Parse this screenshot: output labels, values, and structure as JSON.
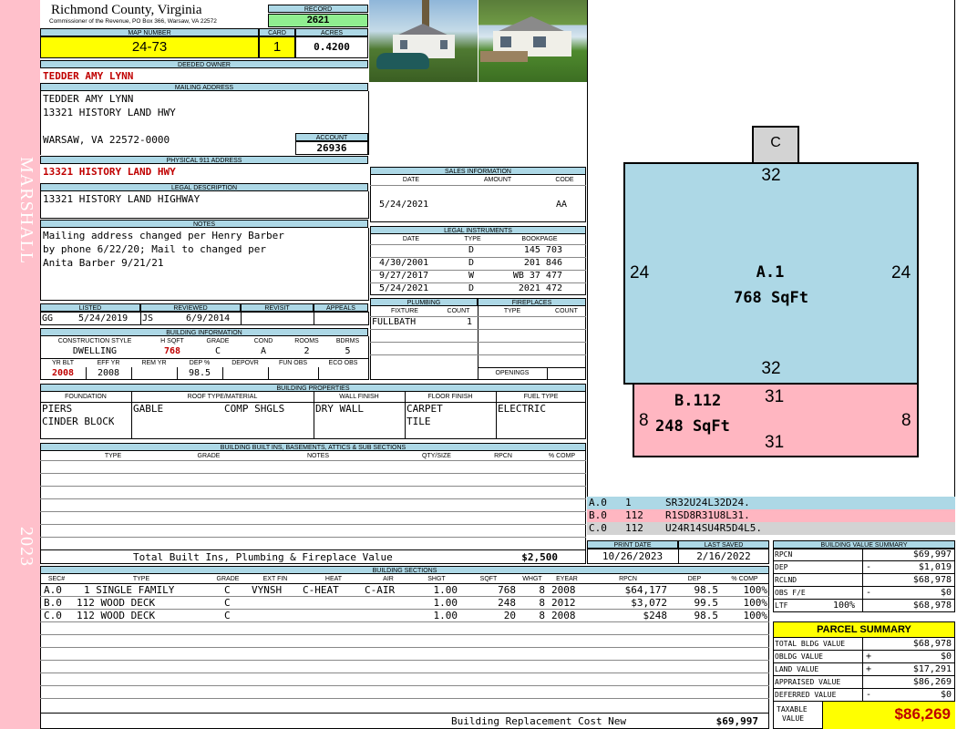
{
  "sidebar": {
    "top_text": "MARSHALL",
    "bottom_text": "2023"
  },
  "header": {
    "county": "Richmond County, Virginia",
    "commissioner": "Commissioner of the Revenue, PO Box 366, Warsaw, VA 22572",
    "record_label": "RECORD",
    "record_value": "2621",
    "map_label": "MAP NUMBER",
    "map_value": "24-73",
    "card_label": "CARD",
    "card_value": "1",
    "acres_label": "ACRES",
    "acres_value": "0.4200"
  },
  "owner": {
    "deeded_label": "DEEDED OWNER",
    "deeded_value": "TEDDER AMY LYNN",
    "mailing_label": "MAILING ADDRESS",
    "mailing_line1": "TEDDER AMY LYNN",
    "mailing_line2": "13321 HISTORY LAND HWY",
    "mailing_line3": "WARSAW, VA 22572-0000",
    "account_label": "ACCOUNT",
    "account_value": "26936",
    "physical_label": "PHYSICAL 911 ADDRESS",
    "physical_value": "13321 HISTORY LAND HWY",
    "legal_label": "LEGAL DESCRIPTION",
    "legal_value": "13321 HISTORY LAND HIGHWAY",
    "notes_label": "NOTES",
    "notes_line1": "Mailing address changed per Henry Barber",
    "notes_line2": "by phone 6/22/20; Mail to changed per",
    "notes_line3": "Anita Barber 9/21/21"
  },
  "review": {
    "listed_label": "LISTED",
    "reviewed_label": "REVIEWED",
    "revisit_label": "REVISIT",
    "appeals_label": "APPEALS",
    "listed_by": "GG",
    "listed_date": "5/24/2019",
    "reviewed_by": "JS",
    "reviewed_date": "6/9/2014"
  },
  "building_info": {
    "label": "BUILDING INFORMATION",
    "h_style": "CONSTRUCTION STYLE",
    "h_sqft": "H SQFT",
    "h_grade": "GRADE",
    "h_cond": "COND",
    "h_rooms": "ROOMS",
    "h_bdrms": "BDRMS",
    "style": "DWELLING",
    "sqft": "768",
    "grade": "C",
    "cond": "A",
    "rooms": "2",
    "bdrms": "5",
    "h_yrblt": "YR BLT",
    "h_effyr": "EFF YR",
    "h_remyr": "REM YR",
    "h_dep": "DEP %",
    "h_depovr": "DEPOVR",
    "h_funobs": "FUN OBS",
    "h_ecoobs": "ECO OBS",
    "yrblt": "2008",
    "effyr": "2008",
    "dep": "98.5"
  },
  "sales": {
    "label": "SALES INFORMATION",
    "h_date": "DATE",
    "h_amount": "AMOUNT",
    "h_code": "CODE",
    "date": "5/24/2021",
    "code": "AA"
  },
  "legal_instruments": {
    "label": "LEGAL INSTRUMENTS",
    "h_date": "DATE",
    "h_type": "TYPE",
    "h_book": "BOOKPAGE",
    "rows": [
      {
        "date": "",
        "type": "D",
        "book": "145 703"
      },
      {
        "date": "4/30/2001",
        "type": "D",
        "book": "201 846"
      },
      {
        "date": "9/27/2017",
        "type": "W",
        "book": "WB 37 477"
      },
      {
        "date": "5/24/2021",
        "type": "D",
        "book": "2021 472"
      }
    ]
  },
  "plumbing": {
    "label": "PLUMBING",
    "h_fixture": "FIXTURE",
    "h_count": "COUNT",
    "fixture": "FULLBATH",
    "count": "1"
  },
  "fireplaces": {
    "label": "FIREPLACES",
    "h_type": "TYPE",
    "h_count": "COUNT",
    "openings_label": "OPENINGS"
  },
  "properties": {
    "label": "BUILDING PROPERTIES",
    "h_foundation": "FOUNDATION",
    "h_roof": "ROOF TYPE/MATERIAL",
    "h_wall": "WALL FINISH",
    "h_floor": "FLOOR FINISH",
    "h_fuel": "FUEL TYPE",
    "foundation1": "PIERS",
    "foundation2": "CINDER BLOCK",
    "roof_type": "GABLE",
    "roof_material": "COMP SHGLS",
    "wall": "DRY WALL",
    "floor1": "CARPET",
    "floor2": "TILE",
    "fuel": "ELECTRIC"
  },
  "builtins": {
    "label": "BUILDING BUILT INS, BASEMENTS, ATTICS & SUB SECTIONS",
    "h_type": "TYPE",
    "h_grade": "GRADE",
    "h_notes": "NOTES",
    "h_qty": "QTY/SIZE",
    "h_rpcn": "RPCN",
    "h_comp": "% COMP",
    "total_label": "Total Built Ins, Plumbing & Fireplace Value",
    "total_value": "$2,500"
  },
  "sections": {
    "label": "BUILDING SECTIONS",
    "headers": {
      "sec": "SEC#",
      "type": "TYPE",
      "grade": "GRADE",
      "extfin": "EXT FIN",
      "heat": "HEAT",
      "air": "AIR",
      "shgt": "SHGT",
      "sqft": "SQFT",
      "whgt": "WHGT",
      "eyear": "EYEAR",
      "rpcn": "RPCN",
      "dep": "DEP",
      "comp": "% COMP"
    },
    "rows": [
      {
        "sec": "A.0",
        "type": "1 SINGLE FAMILY",
        "grade": "C",
        "extfin": "VYNSH",
        "heat": "C-HEAT",
        "air": "C-AIR",
        "shgt": "1.00",
        "sqft": "768",
        "whgt": "8",
        "eyear": "2008",
        "rpcn": "$64,177",
        "dep": "98.5",
        "comp": "100%"
      },
      {
        "sec": "B.0",
        "type": "112 WOOD DECK",
        "grade": "C",
        "extfin": "",
        "heat": "",
        "air": "",
        "shgt": "1.00",
        "sqft": "248",
        "whgt": "8",
        "eyear": "2012",
        "rpcn": "$3,072",
        "dep": "99.5",
        "comp": "100%"
      },
      {
        "sec": "C.0",
        "type": "112 WOOD DECK",
        "grade": "C",
        "extfin": "",
        "heat": "",
        "air": "",
        "shgt": "1.00",
        "sqft": "20",
        "whgt": "8",
        "eyear": "2008",
        "rpcn": "$248",
        "dep": "98.5",
        "comp": "100%"
      }
    ],
    "replacement_label": "Building Replacement Cost New",
    "replacement_value": "$69,997"
  },
  "sketch": {
    "c_label": "C",
    "a_top": "32",
    "a_bottom": "32",
    "a_left": "24",
    "a_right": "24",
    "a_name": "A.1",
    "a_area": "768 SqFt",
    "b_top": "31",
    "b_bottom": "31",
    "b_left": "8",
    "b_right": "8",
    "b_name": "B.112",
    "b_area": "248 SqFt",
    "colors": {
      "a": "#add8e6",
      "b": "#ffb6c1",
      "c": "#d3d3d3"
    }
  },
  "sketch_codes": [
    {
      "sec": "A.0",
      "num": "1",
      "code": "SR32U24L32D24."
    },
    {
      "sec": "B.0",
      "num": "112",
      "code": "R1SD8R31U8L31."
    },
    {
      "sec": "C.0",
      "num": "112",
      "code": "U24R14SU4R5D4L5."
    }
  ],
  "dates": {
    "print_label": "PRINT DATE",
    "print_value": "10/26/2023",
    "saved_label": "LAST SAVED",
    "saved_value": "2/16/2022"
  },
  "value_summary": {
    "label": "BUILDING VALUE SUMMARY",
    "rows": [
      {
        "label": "RPCN",
        "sign": "",
        "value": "$69,997"
      },
      {
        "label": "DEP",
        "sign": "-",
        "value": "$1,019"
      },
      {
        "label": "RCLND",
        "sign": "",
        "value": "$68,978"
      },
      {
        "label": "OBS F/E",
        "sign": "-",
        "value": "$0"
      },
      {
        "label": "LTF",
        "pct": "100%",
        "sign": "",
        "value": "$68,978"
      }
    ]
  },
  "parcel_summary": {
    "label": "PARCEL SUMMARY",
    "rows": [
      {
        "label": "TOTAL BLDG VALUE",
        "sign": "",
        "value": "$68,978"
      },
      {
        "label": "OBLDG VALUE",
        "sign": "+",
        "value": "$0"
      },
      {
        "label": "LAND VALUE",
        "sign": "+",
        "value": "$17,291"
      },
      {
        "label": "APPRAISED VALUE",
        "sign": "",
        "value": "$86,269"
      },
      {
        "label": "DEFERRED VALUE",
        "sign": "-",
        "value": "$0"
      }
    ],
    "taxable_label1": "TAXABLE",
    "taxable_label2": "VALUE",
    "taxable_value": "$86,269"
  }
}
